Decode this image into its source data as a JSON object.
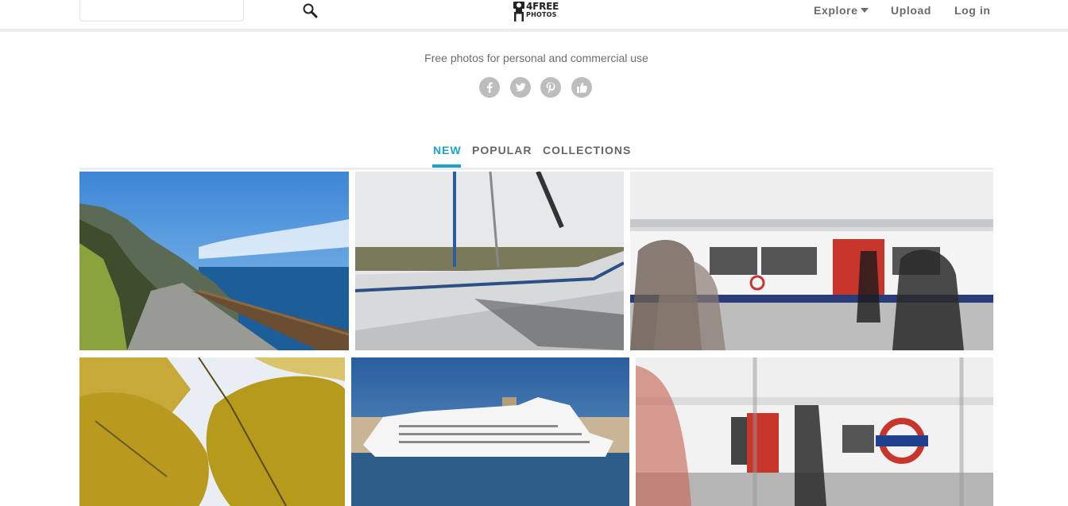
{
  "header": {
    "search_placeholder": "",
    "logo_line1": "4FREE",
    "logo_line2": "PHOTOS",
    "nav": {
      "explore": "Explore",
      "upload": "Upload",
      "login": "Log in"
    }
  },
  "hero": {
    "tagline": "Free photos for personal and commercial use",
    "social": [
      "facebook-icon",
      "twitter-icon",
      "pinterest-icon",
      "thumbs-up-icon"
    ]
  },
  "tabs": {
    "new": "NEW",
    "popular": "POPULAR",
    "collections": "COLLECTIONS",
    "active": "new"
  },
  "colors": {
    "accent": "#1aa3d1",
    "nav_text": "#6a6a6a",
    "social_bg": "#bdbdbd"
  },
  "photos": [
    {
      "subject": "coastal-road-photo"
    },
    {
      "subject": "sailboat-photo"
    },
    {
      "subject": "subway-platform-photo"
    },
    {
      "subject": "autumn-leaves-photo"
    },
    {
      "subject": "cruise-ship-photo"
    },
    {
      "subject": "underground-train-photo"
    }
  ]
}
